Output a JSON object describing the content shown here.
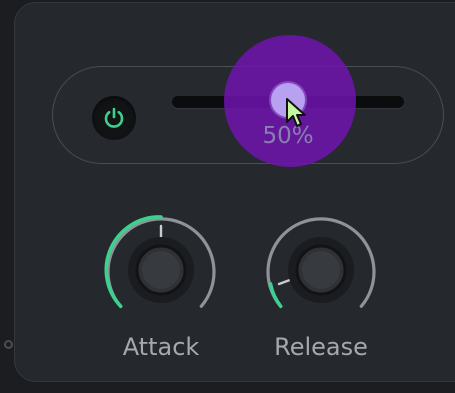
{
  "mix": {
    "power_on": true,
    "value_label": "50%",
    "value_fraction": 0.5
  },
  "knobs": [
    {
      "label": "Attack",
      "value_fraction": 0.5
    },
    {
      "label": "Release",
      "value_fraction": 0.08
    }
  ],
  "colors": {
    "accent_green": "#3ed08f",
    "highlight_purple": "#7014af",
    "thumb_lilac": "#b9a1f2",
    "panel": "#25282c",
    "background": "#1b1d20"
  },
  "icons": {
    "power": "power-icon",
    "cursor": "pointer-cursor-icon"
  }
}
